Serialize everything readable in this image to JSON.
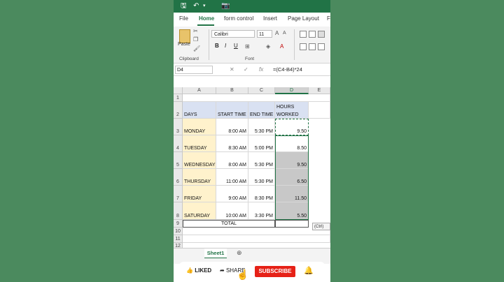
{
  "titlebar": {
    "icons": [
      "save-icon",
      "undo-icon",
      "dropdown-icon",
      "camera-icon"
    ]
  },
  "tabs": [
    "File",
    "Home",
    "form control",
    "Insert",
    "Page Layout",
    "F"
  ],
  "active_tab": "Home",
  "ribbon": {
    "paste_label": "Paste",
    "clipboard_label": "Clipboard",
    "font_name": "Calibri",
    "font_size": "11",
    "font_label": "Font",
    "bold": "B",
    "italic": "I",
    "underline": "U"
  },
  "formula_bar": {
    "namebox": "D4",
    "fx": "fx",
    "formula": "=(C4-B4)*24"
  },
  "columns": [
    "A",
    "B",
    "C",
    "D",
    "E"
  ],
  "header_row": {
    "days": "DAYS",
    "start": "START TIME",
    "end": "END TIME",
    "hours_line1": "HOURS",
    "hours_line2": "WORKED"
  },
  "rows": [
    {
      "day": "MONDAY",
      "start": "8:00 AM",
      "end": "5:30 PM",
      "hours": "9.50"
    },
    {
      "day": "TUESDAY",
      "start": "8:30 AM",
      "end": "5:00 PM",
      "hours": "8.50"
    },
    {
      "day": "WEDNESDAY",
      "start": "8:00 AM",
      "end": "5:30 PM",
      "hours": "9.50"
    },
    {
      "day": "THURSDAY",
      "start": "11:00 AM",
      "end": "5:30 PM",
      "hours": "6.50"
    },
    {
      "day": "FRIDAY",
      "start": "9:00 AM",
      "end": "8:30 PM",
      "hours": "11.50"
    },
    {
      "day": "SATURDAY",
      "start": "10:00 AM",
      "end": "3:30 PM",
      "hours": "5.50"
    }
  ],
  "total_label": "TOTAL",
  "row_numbers": [
    "1",
    "2",
    "3",
    "4",
    "5",
    "6",
    "7",
    "8",
    "9",
    "10",
    "11",
    "12"
  ],
  "paste_options": "(Ctrl)",
  "sheet_tab": "Sheet1",
  "youtube": {
    "like": "LIKED",
    "share": "SHARE",
    "subscribe": "SUBSCRIBE"
  },
  "colors": {
    "excel_green": "#217346",
    "background": "#4b8a5e",
    "header_blue": "#d9e1f2",
    "day_yellow": "#fff2cc",
    "subscribe_red": "#e62117"
  }
}
